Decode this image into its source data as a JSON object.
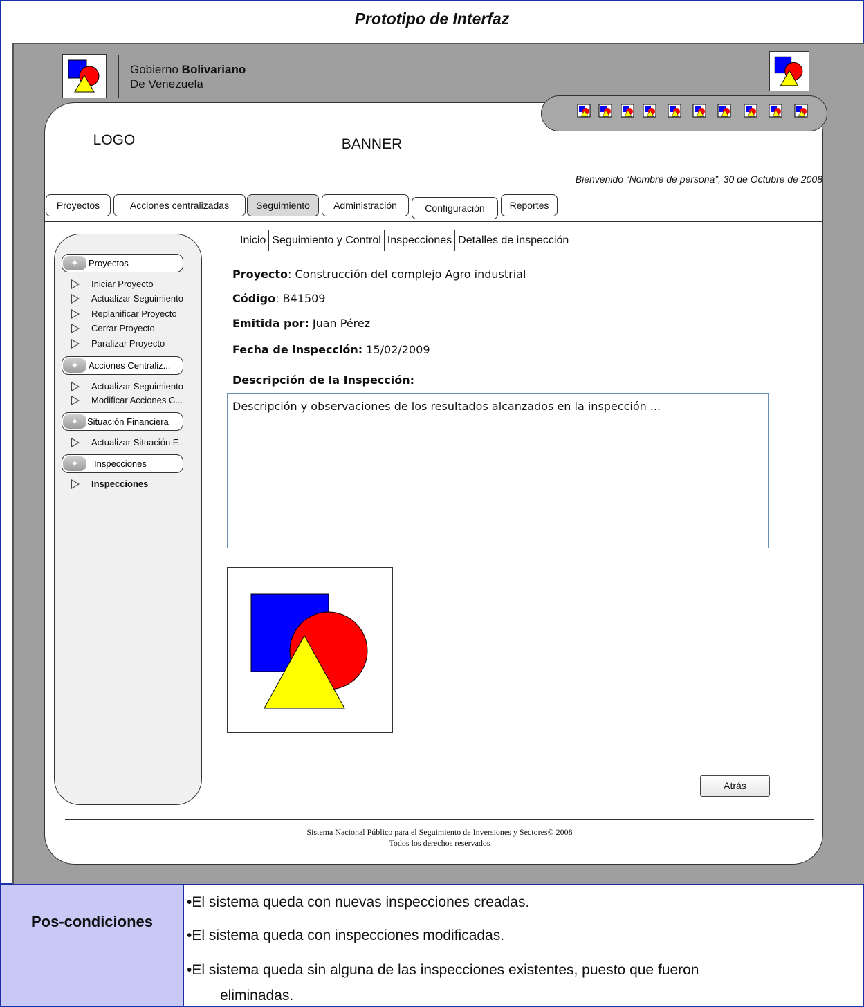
{
  "prototype_title": "Prototipo de Interfaz",
  "gov": {
    "line1_normal": "Gobierno ",
    "line1_bold": "Bolivariano",
    "line2": "De Venezuela"
  },
  "header": {
    "logo": "LOGO",
    "banner": "BANNER",
    "welcome": "Bienvenido “Nombre de persona”, 30 de Octubre de 2008"
  },
  "tabs": [
    {
      "label": "Proyectos"
    },
    {
      "label": "Acciones centralizadas"
    },
    {
      "label": "Seguimiento",
      "active": true
    },
    {
      "label": "Administración"
    },
    {
      "label": "Configuración"
    },
    {
      "label": "Reportes"
    }
  ],
  "sidebar": {
    "groups": [
      {
        "title": "Proyectos",
        "items": [
          "Iniciar Proyecto",
          "Actualizar Seguimiento",
          "Replanificar Proyecto",
          "Cerrar Proyecto",
          "Paralizar Proyecto"
        ]
      },
      {
        "title": "Acciones Centraliz...",
        "items": [
          "Actualizar Seguimiento",
          "Modificar Acciones C..."
        ]
      },
      {
        "title": "Situación Financiera",
        "items": [
          "Actualizar Situación F.."
        ]
      },
      {
        "title": "Inspecciones",
        "items": [
          "Inspecciones"
        ]
      }
    ]
  },
  "breadcrumb": [
    "Inicio",
    "Seguimiento y Control",
    "Inspecciones",
    "Detalles de inspección"
  ],
  "details": {
    "proyecto_label": "Proyecto",
    "proyecto_value": ": Construcción del complejo Agro industrial",
    "codigo_label": "Código",
    "codigo_value": ": B41509",
    "emitida_label": "Emitida por:",
    "emitida_value": " Juan Pérez",
    "fecha_label": "Fecha de inspección:",
    "fecha_value": " 15/02/2009",
    "descripcion_label": "Descripción de la Inspección:",
    "descripcion_text": "Descripción y observaciones de los resultados alcanzados en la inspección    ..."
  },
  "back_button": "Atrás",
  "footer": {
    "line1": "Sistema Nacional Público para el Seguimiento de Inversiones y Sectores© 2008",
    "line2": "Todos los derechos reservados"
  },
  "postconditions": {
    "label": "Pos-condiciones",
    "bullets": [
      "•El sistema queda con nuevas inspecciones creadas.",
      "•El sistema queda con inspecciones modificadas.",
      "•El sistema queda sin alguna de las inspecciones existentes, puesto que fueron",
      "eliminadas."
    ]
  },
  "colors": {
    "frame_border": "#1b2fa8",
    "label_cell": "#c9c9f7",
    "gray_bg": "#9f9f9f",
    "shape_blue": "#0000ff",
    "shape_red": "#ff0000",
    "shape_yellow": "#ffff00"
  },
  "icons": [
    "shapes-logo-icon",
    "toolbar-shape-icon"
  ]
}
